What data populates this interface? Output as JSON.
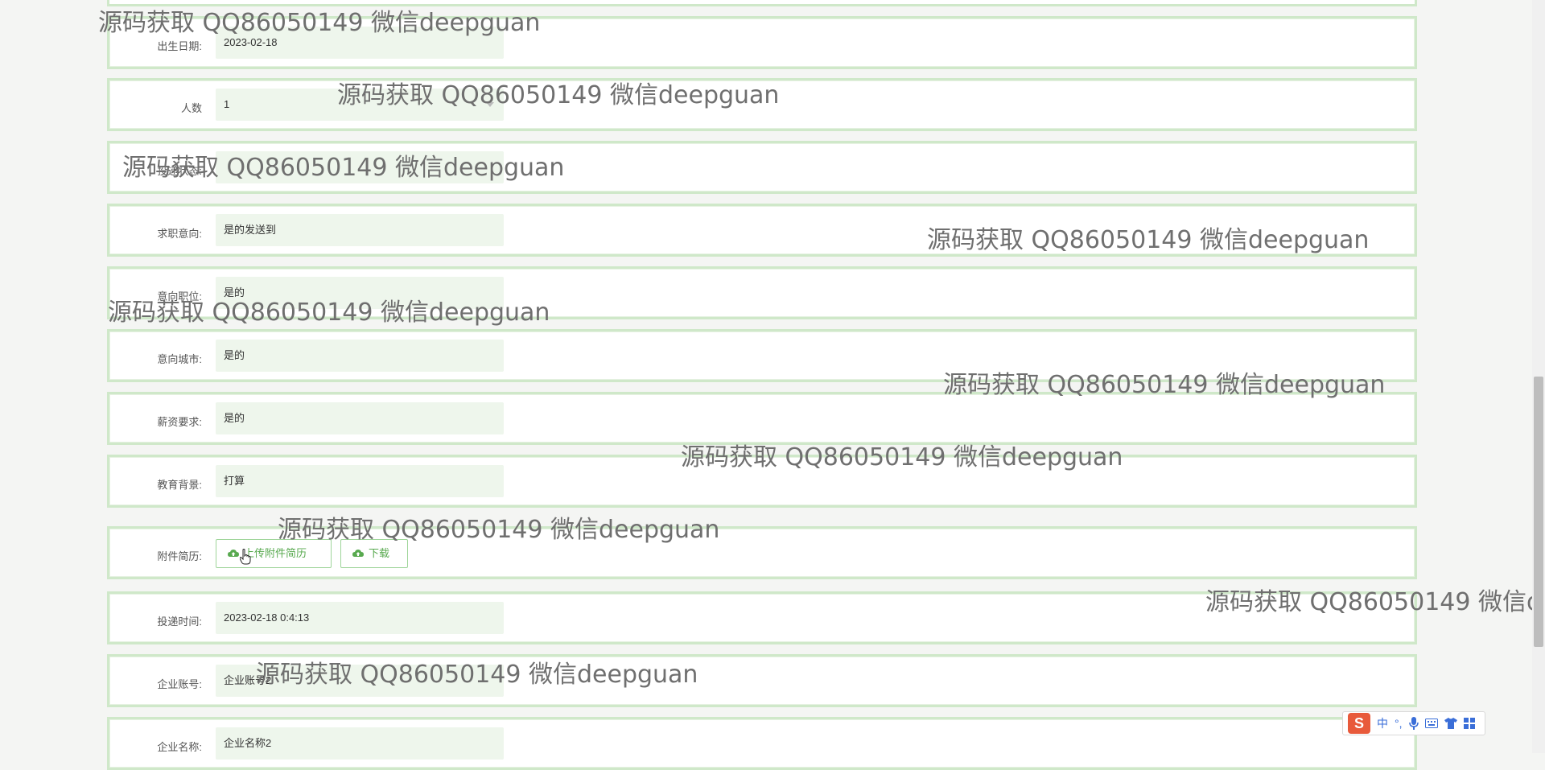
{
  "form": {
    "birth_label": "出生日期:",
    "birth_value": "2023-02-18",
    "people_label": "人数",
    "people_value": "1",
    "status_label": "投递状态:",
    "intent_label": "求职意向:",
    "intent_value": "是的发送到",
    "position_label": "意向职位:",
    "position_value": "是的",
    "city_label": "意向城市:",
    "city_value": "是的",
    "salary_label": "薪资要求:",
    "salary_value": "是的",
    "edu_label": "教育背景:",
    "edu_value": "打算",
    "resume_label": "附件简历:",
    "upload_button": "上传附件简历",
    "download_button": "下载",
    "time_label": "投递时间:",
    "time_value": "2023-02-18 0:4:13",
    "company_acct_label": "企业账号:",
    "company_acct_value": "企业账号2",
    "company_name_label": "企业名称:",
    "company_name_value": "企业名称2"
  },
  "watermark_text": "源码获取 QQ86050149 微信deepguan",
  "ime": {
    "logo": "S",
    "mode": "中",
    "punct": "°,",
    "icons": [
      "mic-icon",
      "keyboard-icon",
      "shirt-icon",
      "grid-icon"
    ]
  },
  "colors": {
    "row_border": "#cfe8c9",
    "field_bg": "#eef6ec",
    "accent_green": "#58a94f",
    "watermark": "#6f6f6f"
  }
}
